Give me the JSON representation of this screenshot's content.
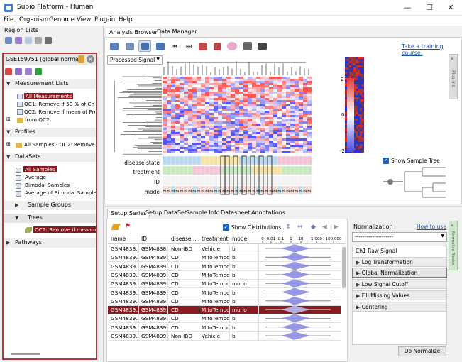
{
  "window": {
    "title": "Subio Platform - Human",
    "minimize": "—",
    "maximize": "☐",
    "close": "✕"
  },
  "menu": [
    "File",
    "Organism",
    "Genome",
    "View",
    "Plug-in",
    "Help"
  ],
  "left": {
    "region_lists_label": "Region Lists",
    "document_title": "GSE159751 (global norma...",
    "sections": {
      "measurement_lists": "Measurement Lists",
      "profiles": "Profiles",
      "datasets": "DataSets",
      "sample_groups": "Sample Groups",
      "trees": "Trees",
      "pathways": "Pathways"
    },
    "measurement_items": [
      "All Measurements",
      "QC1: Remove if 50 % of Ch1F",
      "QC2: Remove if mean of Pro",
      "from QC2"
    ],
    "profile_items": [
      "All Samples - QC2: Remove i"
    ],
    "dataset_items": [
      "All Samples",
      "Average",
      "Bimodal Samples",
      "Average of Bimodal Samples"
    ],
    "tree_items": [
      "QC2: Remove if mean of"
    ]
  },
  "main": {
    "tabs": [
      "Analysis Browser",
      "Data Manager"
    ],
    "training_link": "Take a training course.",
    "signal_dropdown": "Processed Signal",
    "side_tab_plugins": "Plug-ins",
    "scale": {
      "max": "2",
      "mid": "0",
      "min": "-2"
    },
    "row_labels": [
      "disease state",
      "treatment",
      "ID",
      "mode"
    ],
    "mode_values": [
      "bi",
      "bi",
      "bi",
      "bi",
      "bi",
      "bi",
      "bi",
      "bi",
      "bi",
      "bi",
      "bi",
      "bi",
      "bi",
      "bi",
      "bi",
      "bi",
      "bi",
      "bi",
      "bi",
      "bi",
      "bi",
      "bi",
      "bi",
      "bi",
      "bi",
      "bi",
      "bi",
      "bi",
      "bi",
      "bi",
      "bi",
      "bi",
      "bi",
      "bi",
      "bi"
    ],
    "show_sample_tree": "Show Sample Tree",
    "show_sample_tree_checked": true
  },
  "lower": {
    "tabs": [
      "Setup Series",
      "Setup DataSet",
      "Sample Info",
      "Datasheet",
      "Annotations"
    ],
    "show_distributions": "Show Distributions",
    "show_distributions_checked": true,
    "columns": [
      "name",
      "ID",
      "disease ...",
      "treatment",
      "mode"
    ],
    "scale_ticks": [
      "0",
      "0.01",
      "0.1",
      "1",
      "10",
      "1,000",
      "100,000"
    ],
    "rows": [
      [
        "GSM4838...",
        "GSM4838...",
        "Non-IBD",
        "Vehicle",
        "bi"
      ],
      [
        "GSM4839...",
        "GSM4839...",
        "CD",
        "MitoTempo",
        "bi"
      ],
      [
        "GSM4839...",
        "GSM4839...",
        "CD",
        "MitoTempo",
        "bi"
      ],
      [
        "GSM4839...",
        "GSM4839...",
        "CD",
        "MitoTempo",
        "bi"
      ],
      [
        "GSM4839...",
        "GSM4839...",
        "CD",
        "MitoTempo",
        "mono"
      ],
      [
        "GSM4839...",
        "GSM4839...",
        "CD",
        "MitoTempo",
        "bi"
      ],
      [
        "GSM4839...",
        "GSM4839...",
        "CD",
        "MitoTempo",
        "bi"
      ],
      [
        "GSM4839...",
        "GSM4839...",
        "CD",
        "MitoTempo",
        "mono"
      ],
      [
        "GSM4839...",
        "GSM4839...",
        "CD",
        "MitoTempo",
        "bi"
      ],
      [
        "GSM4839...",
        "GSM4839...",
        "CD",
        "MitoTempo",
        "bi"
      ],
      [
        "GSM4839...",
        "GSM4839...",
        "Non-IBD",
        "Vehicle",
        "bi"
      ]
    ],
    "selected_row_index": 7,
    "normalization": {
      "label": "Normalization",
      "how_to_use": "How to use",
      "dropdown": "--------------------",
      "header": "Ch1 Raw Signal",
      "steps": [
        "Log Transformation",
        "Global Normalization",
        "Low Signal Cutoff",
        "Fill Missing Values",
        "Centering"
      ],
      "selected_step": 1,
      "button": "Do Normalize",
      "side_tab": "Normalize Blocks"
    }
  },
  "colors": {
    "accent_red": "#8b1a20",
    "panel_border": "#b3373b",
    "link": "#1a56b0"
  }
}
